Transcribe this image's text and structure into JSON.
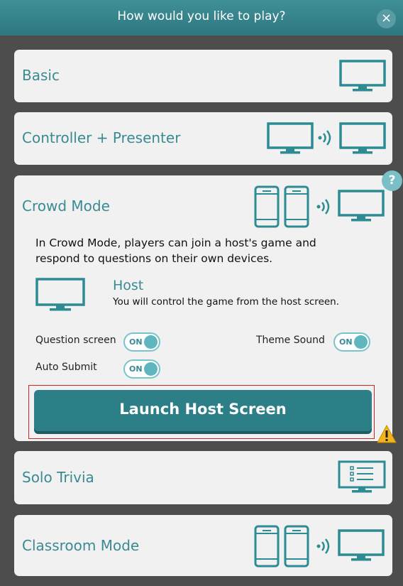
{
  "dialog": {
    "title": "How would you like to play?",
    "close_glyph": "×"
  },
  "modes": {
    "basic": {
      "label": "Basic"
    },
    "controller": {
      "label": "Controller + Presenter"
    },
    "crowd": {
      "label": "Crowd Mode",
      "description": "In Crowd Mode, players can join a host's game and respond to questions on their own devices.",
      "host_title": "Host",
      "host_desc": "You will control the game from the host screen.",
      "options": {
        "question_screen": {
          "label": "Question screen",
          "state": "ON"
        },
        "theme_sound": {
          "label": "Theme Sound",
          "state": "ON"
        },
        "auto_submit": {
          "label": "Auto Submit",
          "state": "ON"
        }
      },
      "launch_label": "Launch Host Screen"
    },
    "solo": {
      "label": "Solo Trivia"
    },
    "classroom": {
      "label": "Classroom Mode"
    }
  },
  "help_glyph": "?",
  "colors": {
    "accent": "#2d7f87",
    "text_accent": "#3a8a93",
    "header": "#3f8f97"
  }
}
